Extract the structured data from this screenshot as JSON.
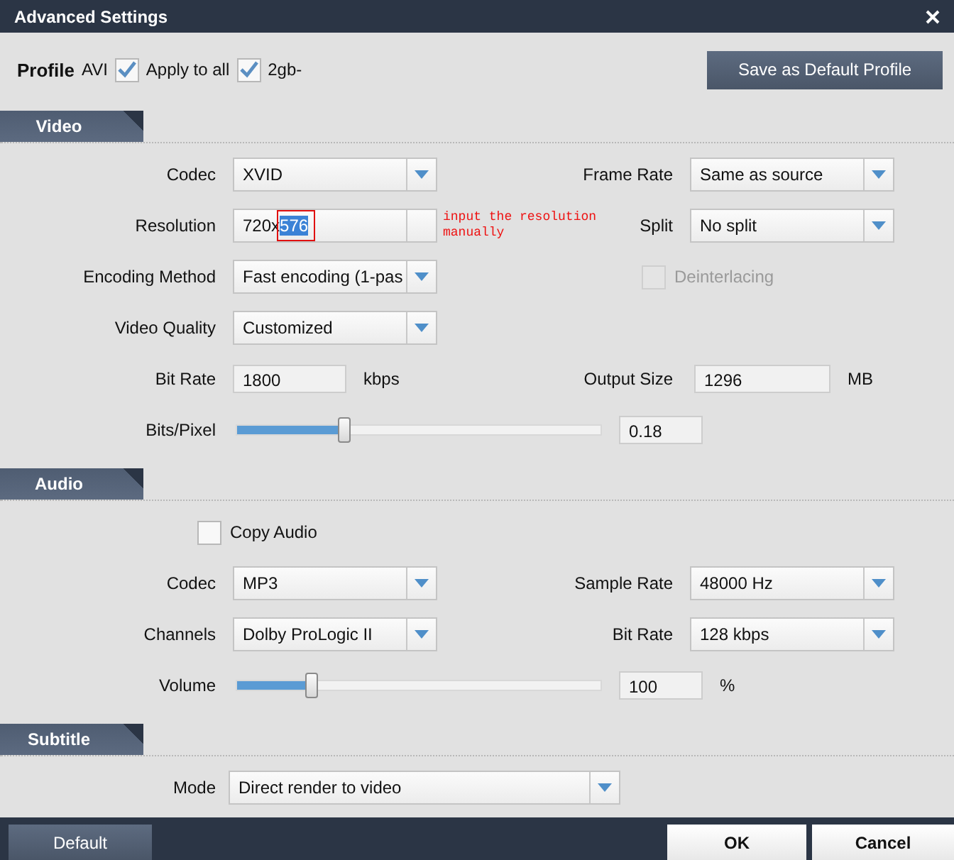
{
  "window": {
    "title": "Advanced Settings"
  },
  "profile": {
    "label": "Profile",
    "name": "AVI",
    "options": [
      {
        "label": "Apply to all",
        "checked": true
      },
      {
        "label": "2gb-",
        "checked": true
      }
    ],
    "save_button": "Save as Default Profile"
  },
  "sections": [
    {
      "title": "Video",
      "rows": [
        [
          {
            "kind": "dropdown",
            "label": "Codec",
            "value": "XVID"
          },
          {
            "kind": "dropdown",
            "label": "Frame Rate",
            "value": "Same as source"
          }
        ],
        [
          {
            "kind": "resolution",
            "label": "Resolution",
            "value": "720x",
            "selected_text": "576",
            "annotation": "input the resolution manually"
          },
          {
            "kind": "dropdown",
            "label": "Split",
            "value": "No split"
          }
        ],
        [
          {
            "kind": "dropdown",
            "label": "Encoding Method",
            "value": "Fast encoding (1-pas"
          },
          {
            "kind": "checkbox",
            "label": "Deinterlacing",
            "checked": false,
            "disabled": true
          }
        ],
        [
          {
            "kind": "dropdown",
            "label": "Video Quality",
            "value": "Customized"
          }
        ],
        [
          {
            "kind": "input",
            "label": "Bit Rate",
            "value": "1800",
            "unit": "kbps"
          },
          {
            "kind": "input",
            "label": "Output Size",
            "value": "1296",
            "unit": "MB"
          }
        ],
        [
          {
            "kind": "slider",
            "label": "Bits/Pixel",
            "level": 0.3,
            "value": "0.18"
          }
        ]
      ]
    },
    {
      "title": "Audio",
      "rows": [
        [
          {
            "kind": "checkbox",
            "label": "Copy Audio",
            "checked": false,
            "disabled": false
          }
        ],
        [
          {
            "kind": "dropdown",
            "label": "Codec",
            "value": "MP3"
          },
          {
            "kind": "dropdown",
            "label": "Sample Rate",
            "value": "48000 Hz"
          }
        ],
        [
          {
            "kind": "dropdown",
            "label": "Channels",
            "value": "Dolby ProLogic II"
          },
          {
            "kind": "dropdown",
            "label": "Bit Rate",
            "value": "128 kbps"
          }
        ],
        [
          {
            "kind": "slider",
            "label": "Volume",
            "level": 0.21,
            "value": "100",
            "unit": "%"
          }
        ]
      ]
    },
    {
      "title": "Subtitle",
      "rows": [
        [
          {
            "kind": "wide_dropdown",
            "label": "Mode",
            "value": "Direct render to video"
          }
        ]
      ]
    }
  ],
  "footer": [
    {
      "label": "Default",
      "kind": "secondary"
    },
    {
      "label": "OK",
      "kind": "primary"
    },
    {
      "label": "Cancel",
      "kind": "primary"
    }
  ]
}
